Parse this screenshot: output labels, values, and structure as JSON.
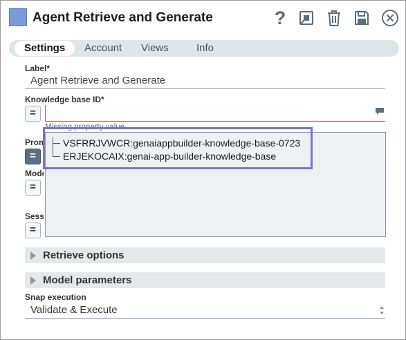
{
  "header": {
    "title": "Agent Retrieve and Generate",
    "help_label": "?"
  },
  "tabs": [
    {
      "label": "Settings"
    },
    {
      "label": "Account"
    },
    {
      "label": "Views"
    },
    {
      "label": "Info"
    }
  ],
  "fields": {
    "label": {
      "label": "Label*",
      "value": "Agent Retrieve and Generate"
    },
    "knowledge_base_id": {
      "label": "Knowledge base ID*",
      "value": "",
      "error": "Missing property value"
    },
    "prompt": {
      "label": "Prompt"
    },
    "model": {
      "label": "Model"
    },
    "session": {
      "label": "Session"
    }
  },
  "expr_button_label": "=",
  "dropdown": {
    "options": [
      {
        "label": "VSFRRJVWCR:genaiappbuilder-knowledge-base-0723"
      },
      {
        "label": "ERJEKOCAIX:genai-app-builder-knowledge-base"
      }
    ]
  },
  "sections": [
    {
      "label": "Retrieve options"
    },
    {
      "label": "Model parameters"
    }
  ],
  "snap_execution": {
    "label": "Snap execution",
    "value": "Validate & Execute"
  },
  "colors": {
    "accent_highlight": "#7e6fd3",
    "error": "#d9534f",
    "icon": "#5a6e7c"
  }
}
